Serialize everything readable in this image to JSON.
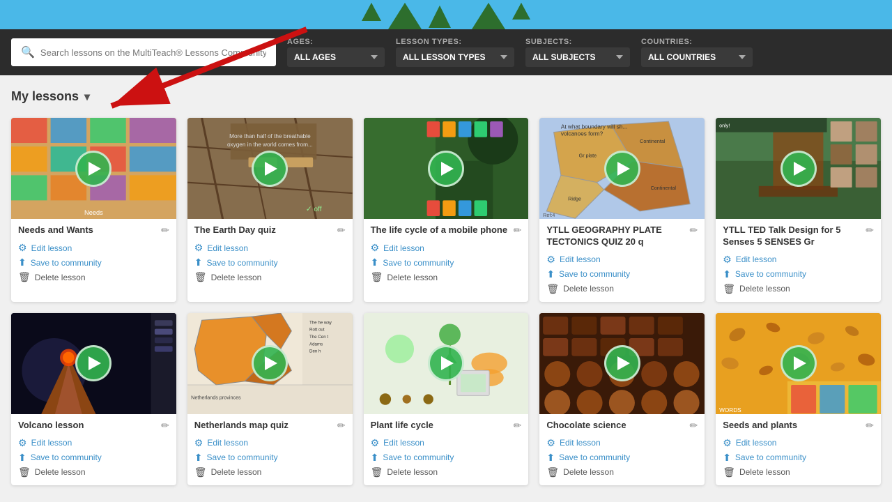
{
  "header": {
    "banner_color": "#4ab8e8"
  },
  "toolbar": {
    "search_placeholder": "Search lessons on the MultiTeach® Lessons Community",
    "ages_label": "AGES:",
    "ages_value": "ALL AGES",
    "lesson_types_label": "LESSON TYPES:",
    "lesson_types_value": "ALL LESSON TYPES",
    "subjects_label": "SUBJECTS:",
    "subjects_value": "ALL SUBJECTS",
    "countries_label": "COUNTRIES:",
    "countries_value": "ALL COUNTRIES"
  },
  "section": {
    "my_lessons_label": "My lessons"
  },
  "lessons": [
    {
      "id": 1,
      "title": "Needs and Wants",
      "thumb_class": "thumb-1",
      "edit_label": "Edit lesson",
      "save_label": "Save to community",
      "delete_label": "Delete lesson"
    },
    {
      "id": 2,
      "title": "The Earth Day quiz",
      "thumb_class": "thumb-2",
      "edit_label": "Edit lesson",
      "save_label": "Save to community",
      "delete_label": "Delete lesson"
    },
    {
      "id": 3,
      "title": "The life cycle of a mobile phone",
      "thumb_class": "thumb-3",
      "edit_label": "Edit lesson",
      "save_label": "Save to community",
      "delete_label": "Delete lesson"
    },
    {
      "id": 4,
      "title": "YTLL GEOGRAPHY PLATE TECTONICS QUIZ 20 q",
      "thumb_class": "thumb-4",
      "edit_label": "Edit lesson",
      "save_label": "Save to community",
      "delete_label": "Delete lesson"
    },
    {
      "id": 5,
      "title": "YTLL TED Talk Design for 5 Senses 5 SENSES Gr",
      "thumb_class": "thumb-5",
      "edit_label": "Edit lesson",
      "save_label": "Save to community",
      "delete_label": "Delete lesson"
    },
    {
      "id": 6,
      "title": "Volcano lesson",
      "thumb_class": "thumb-6",
      "edit_label": "Edit lesson",
      "save_label": "Save to community",
      "delete_label": "Delete lesson"
    },
    {
      "id": 7,
      "title": "Netherlands map quiz",
      "thumb_class": "thumb-7",
      "edit_label": "Edit lesson",
      "save_label": "Save to community",
      "delete_label": "Delete lesson"
    },
    {
      "id": 8,
      "title": "Plant life cycle",
      "thumb_class": "thumb-8",
      "edit_label": "Edit lesson",
      "save_label": "Save to community",
      "delete_label": "Delete lesson"
    },
    {
      "id": 9,
      "title": "Chocolate science",
      "thumb_class": "thumb-9",
      "edit_label": "Edit lesson",
      "save_label": "Save to community",
      "delete_label": "Delete lesson"
    },
    {
      "id": 10,
      "title": "Seeds and plants",
      "thumb_class": "thumb-10",
      "edit_label": "Edit lesson",
      "save_label": "Save to community",
      "delete_label": "Delete lesson"
    }
  ],
  "actions": {
    "edit_icon": "✏",
    "save_icon": "⬆",
    "delete_icon": "🗑",
    "play_icon": "▶",
    "search_icon": "🔍"
  }
}
